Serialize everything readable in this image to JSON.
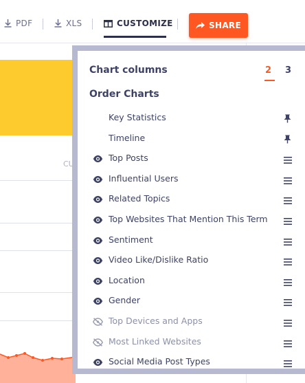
{
  "toolbar": {
    "pdf_label": "PDF",
    "xls_label": "XLS",
    "customize_label": "CUSTOMIZE",
    "share_label": "SHARE"
  },
  "background": {
    "cut_text": "CU"
  },
  "panel": {
    "chart_columns_label": "Chart columns",
    "column_options": [
      "2",
      "3"
    ],
    "selected_columns": "2",
    "order_charts_label": "Order Charts",
    "items": [
      {
        "label": "Key Statistics",
        "visibility": "fixed",
        "icon": "pin-icon"
      },
      {
        "label": "Timeline",
        "visibility": "fixed",
        "icon": "pin-icon"
      },
      {
        "label": "Top Posts",
        "visibility": "visible",
        "icon": "drag-handle-icon"
      },
      {
        "label": "Influential Users",
        "visibility": "visible",
        "icon": "drag-handle-icon"
      },
      {
        "label": "Related Topics",
        "visibility": "visible",
        "icon": "drag-handle-icon"
      },
      {
        "label": "Top Websites That Mention This Term",
        "visibility": "visible",
        "icon": "drag-handle-icon"
      },
      {
        "label": "Sentiment",
        "visibility": "visible",
        "icon": "drag-handle-icon"
      },
      {
        "label": "Video Like/Dislike Ratio",
        "visibility": "visible",
        "icon": "drag-handle-icon"
      },
      {
        "label": "Location",
        "visibility": "visible",
        "icon": "drag-handle-icon"
      },
      {
        "label": "Gender",
        "visibility": "visible",
        "icon": "drag-handle-icon"
      },
      {
        "label": "Top Devices and Apps",
        "visibility": "hidden",
        "icon": "drag-handle-icon"
      },
      {
        "label": "Most Linked Websites",
        "visibility": "hidden",
        "icon": "drag-handle-icon"
      },
      {
        "label": "Social Media Post Types",
        "visibility": "visible",
        "icon": "drag-handle-icon"
      }
    ]
  },
  "colors": {
    "accent": "#ff5722",
    "yellow_tile": "#fdcb2e",
    "panel_border": "#b7b9d0",
    "text": "#3d4266",
    "muted_text": "#8c90a8"
  }
}
